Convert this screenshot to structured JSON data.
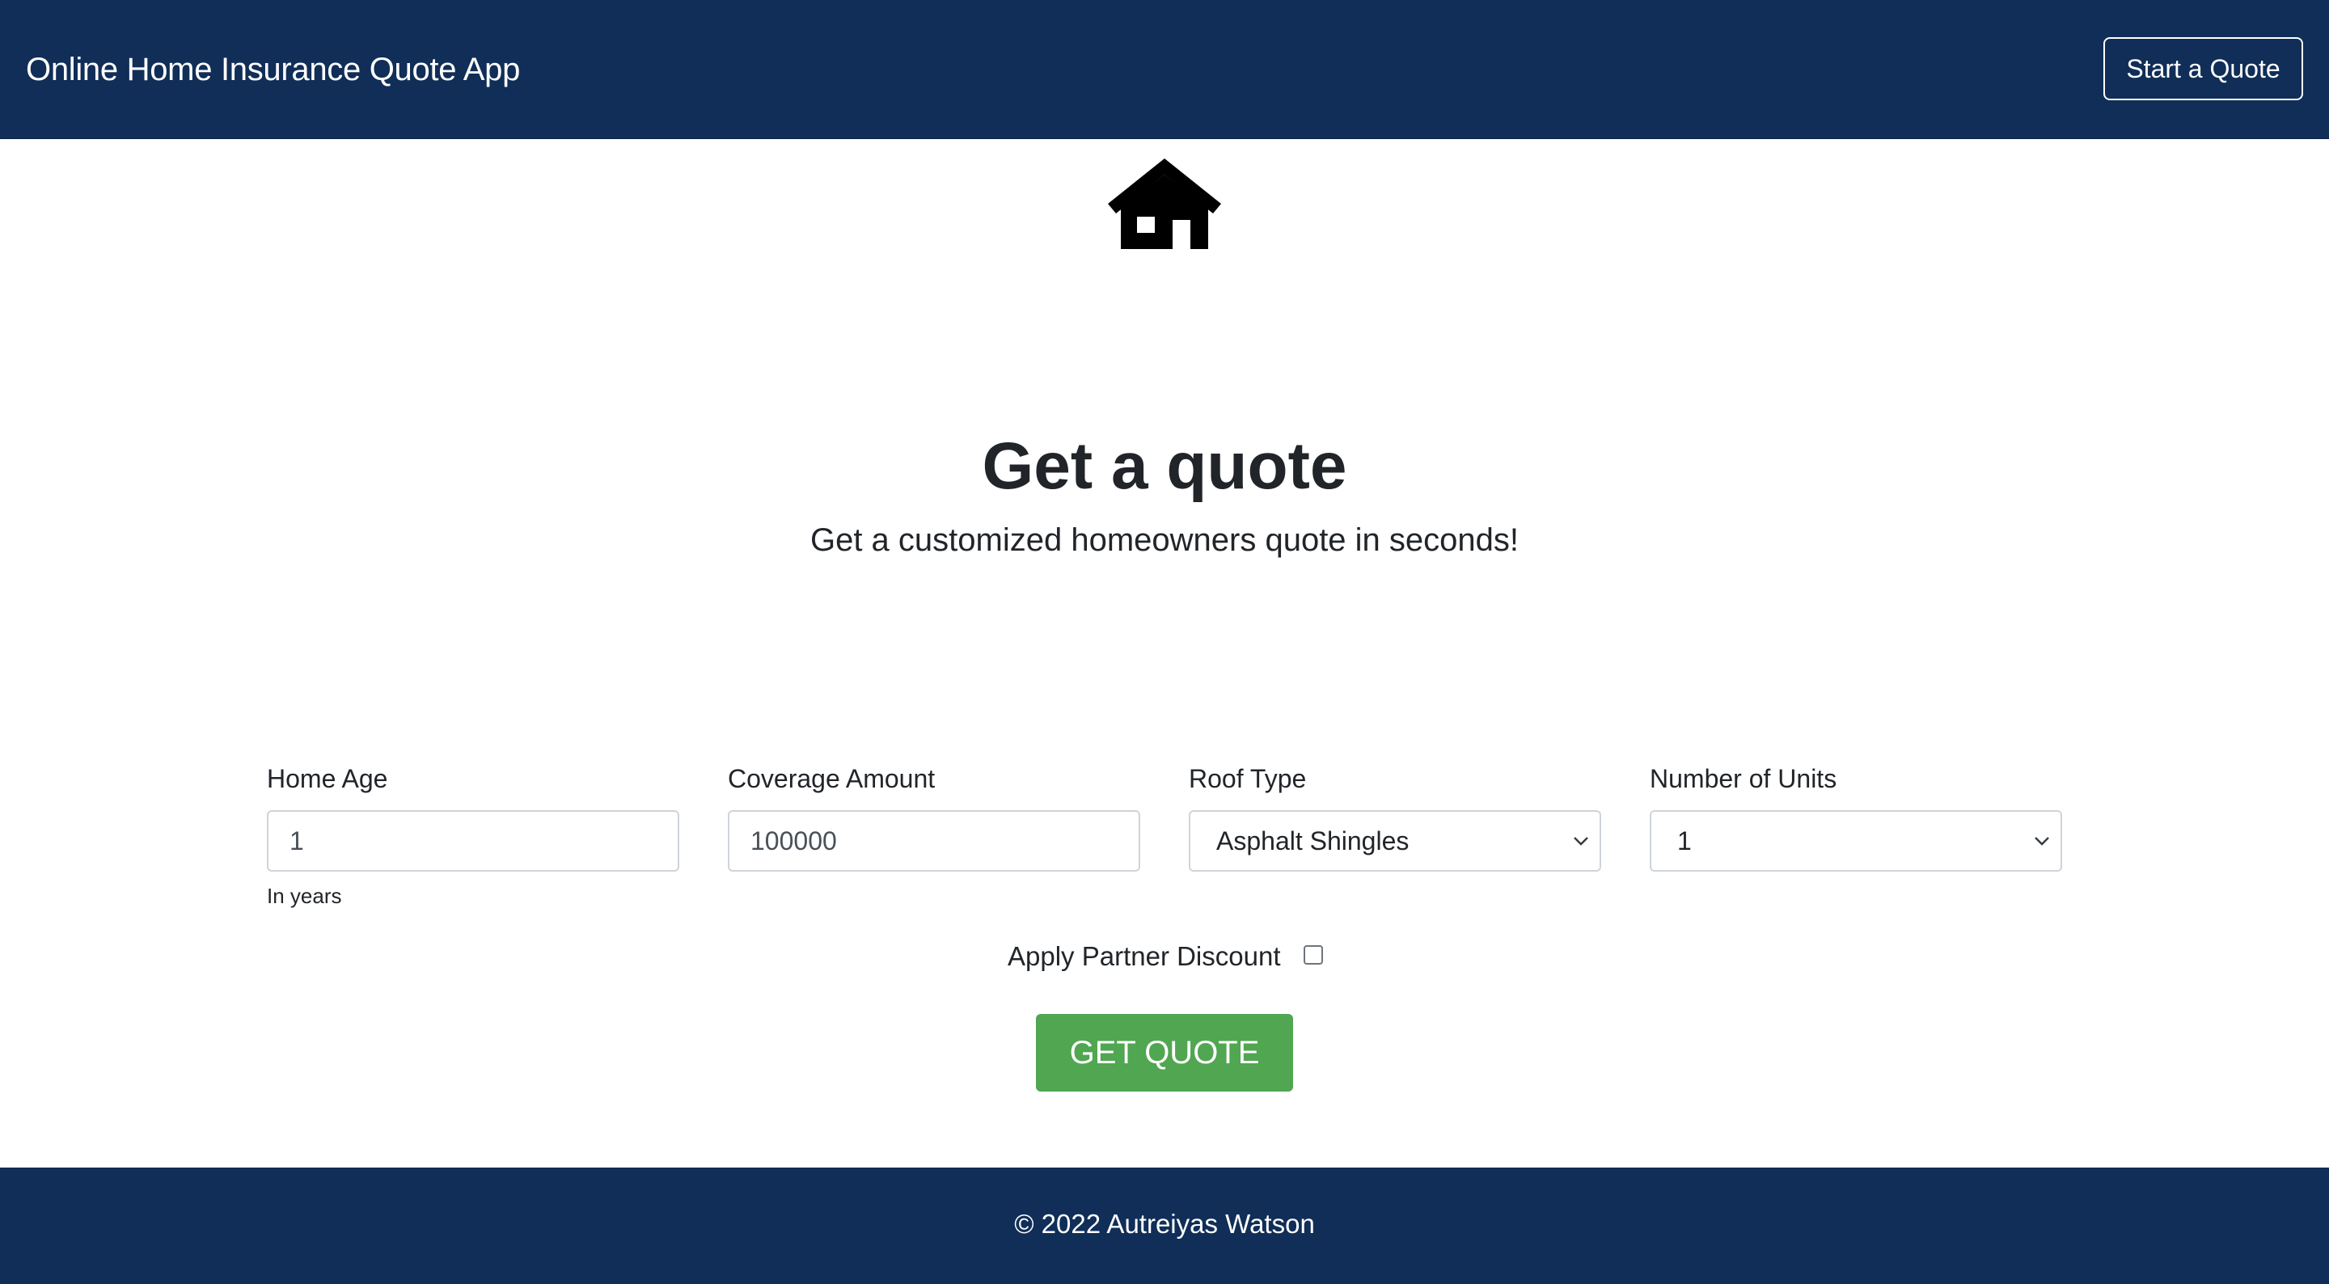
{
  "navbar": {
    "brand": "Online Home Insurance Quote App",
    "start_button": "Start a Quote"
  },
  "hero": {
    "icon": "house-icon",
    "title": "Get a quote",
    "subtitle": "Get a customized homeowners quote in seconds!"
  },
  "form": {
    "home_age": {
      "label": "Home Age",
      "value": "1",
      "help": "In years"
    },
    "coverage_amount": {
      "label": "Coverage Amount",
      "value": "100000"
    },
    "roof_type": {
      "label": "Roof Type",
      "selected": "Asphalt Shingles"
    },
    "number_of_units": {
      "label": "Number of Units",
      "selected": "1"
    },
    "partner_discount": {
      "label": "Apply Partner Discount",
      "checked": false
    },
    "submit_label": "GET QUOTE"
  },
  "footer": {
    "text": "© 2022 Autreiyas Watson"
  },
  "colors": {
    "navbar": "#102e57",
    "footer": "#102e57",
    "primary_button": "#50a651",
    "text": "#212529"
  }
}
